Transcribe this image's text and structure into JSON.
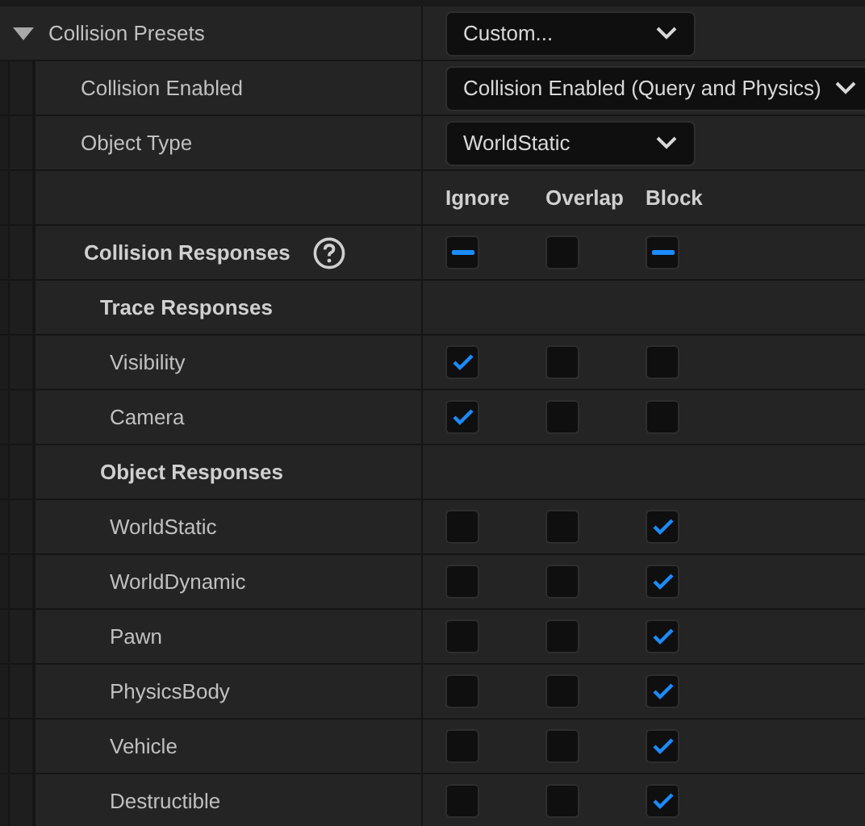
{
  "presets": {
    "label": "Collision Presets",
    "expanded": true,
    "value": "Custom..."
  },
  "properties": [
    {
      "label": "Collision Enabled",
      "value": "Collision Enabled (Query and Physics)"
    },
    {
      "label": "Object Type",
      "value": "WorldStatic"
    }
  ],
  "response_columns": [
    "Ignore",
    "Overlap",
    "Block"
  ],
  "responses": {
    "label": "Collision Responses",
    "boxes": [
      {
        "mixed": true
      },
      {
        "mixed": false
      },
      {
        "mixed": true
      }
    ]
  },
  "groups": [
    {
      "label": "Trace Responses",
      "channels": [
        {
          "label": "Visibility",
          "boxes": [
            {
              "checked": true
            },
            {
              "checked": false
            },
            {
              "checked": false
            }
          ]
        },
        {
          "label": "Camera",
          "boxes": [
            {
              "checked": true
            },
            {
              "checked": false
            },
            {
              "checked": false
            }
          ]
        }
      ]
    },
    {
      "label": "Object Responses",
      "channels": [
        {
          "label": "WorldStatic",
          "boxes": [
            {
              "checked": false
            },
            {
              "checked": false
            },
            {
              "checked": true
            }
          ]
        },
        {
          "label": "WorldDynamic",
          "boxes": [
            {
              "checked": false
            },
            {
              "checked": false
            },
            {
              "checked": true
            }
          ]
        },
        {
          "label": "Pawn",
          "boxes": [
            {
              "checked": false
            },
            {
              "checked": false
            },
            {
              "checked": true
            }
          ]
        },
        {
          "label": "PhysicsBody",
          "boxes": [
            {
              "checked": false
            },
            {
              "checked": false
            },
            {
              "checked": true
            }
          ]
        },
        {
          "label": "Vehicle",
          "boxes": [
            {
              "checked": false
            },
            {
              "checked": false
            },
            {
              "checked": true
            }
          ]
        },
        {
          "label": "Destructible",
          "boxes": [
            {
              "checked": false
            },
            {
              "checked": false
            },
            {
              "checked": true
            }
          ]
        }
      ]
    }
  ]
}
